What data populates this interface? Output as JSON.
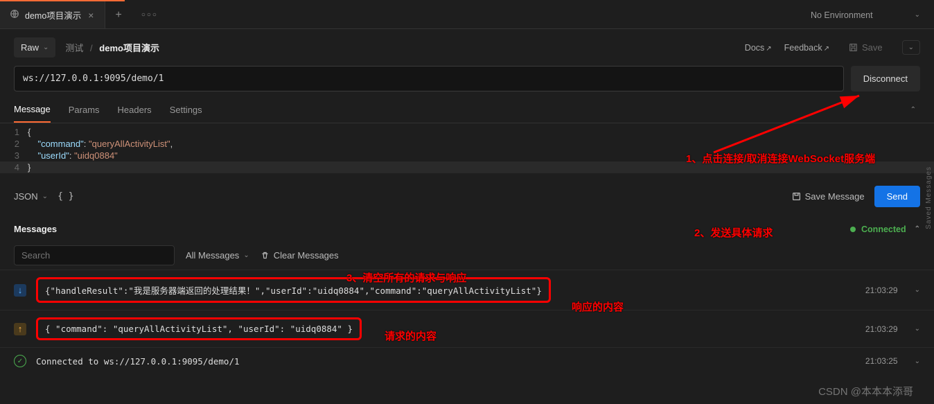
{
  "tab": {
    "title": "demo项目演示"
  },
  "env": {
    "label": "No Environment"
  },
  "raw_btn": "Raw",
  "breadcrumb": {
    "parent": "测试",
    "current": "demo项目演示"
  },
  "links": {
    "docs": "Docs",
    "feedback": "Feedback",
    "save": "Save"
  },
  "url": "ws://127.0.0.1:9095/demo/1",
  "disconnect": "Disconnect",
  "subtabs": {
    "message": "Message",
    "params": "Params",
    "headers": "Headers",
    "settings": "Settings"
  },
  "editor": {
    "lines": [
      "{",
      "\"command\": \"queryAllActivityList\",",
      "\"userId\": \"uidq0884\"",
      "}"
    ]
  },
  "json_dd": "JSON",
  "beautify": "{ }",
  "save_message": "Save Message",
  "send": "Send",
  "messages_label": "Messages",
  "connected": "Connected",
  "search_placeholder": "Search",
  "all_messages": "All Messages",
  "clear_messages": "Clear Messages",
  "msgs": [
    {
      "dir": "down",
      "text": "{\"handleResult\":\"我是服务器端返回的处理结果！\",\"userId\":\"uidq0884\",\"command\":\"queryAllActivityList\"}",
      "time": "21:03:29"
    },
    {
      "dir": "up",
      "text": "{ \"command\": \"queryAllActivityList\", \"userId\": \"uidq0884\" }",
      "time": "21:03:29"
    },
    {
      "dir": "ok",
      "text": "Connected to ws://127.0.0.1:9095/demo/1",
      "time": "21:03:25"
    }
  ],
  "annotations": {
    "a1": "1、点击连接/取消连接WebSocket服务端",
    "a2": "2、发送具体请求",
    "a3": "3、清空所有的请求与响应",
    "resp": "响应的内容",
    "req": "请求的内容"
  },
  "side": "Saved Messages",
  "watermark": "CSDN @本本本添哥"
}
